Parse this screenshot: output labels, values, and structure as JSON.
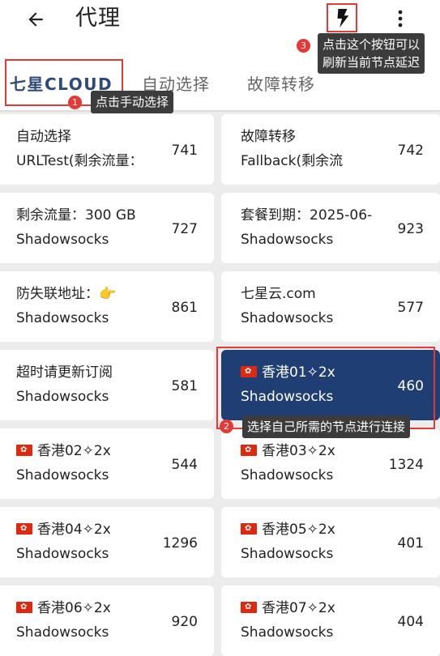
{
  "header": {
    "title": "代理",
    "back_icon": "arrow-left-icon",
    "bolt_icon": "lightning-bolt-icon",
    "more_icon": "more-vertical-icon"
  },
  "tabs": [
    {
      "label": "七星CLOUD",
      "active": true
    },
    {
      "label": "自动选择",
      "active": false
    },
    {
      "label": "故障转移",
      "active": false
    }
  ],
  "proxies": [
    {
      "name": "自动选择",
      "type": "URLTest(剩余流量：",
      "delay": "741"
    },
    {
      "name": "故障转移",
      "type": "Fallback(剩余流",
      "delay": "742"
    },
    {
      "name": "剩余流量：300 GB",
      "type": "Shadowsocks",
      "delay": "727"
    },
    {
      "name": "套餐到期：2025-06-",
      "type": "Shadowsocks",
      "delay": "923"
    },
    {
      "name": "防失联地址：👉",
      "type": "Shadowsocks",
      "delay": "861"
    },
    {
      "name": "七星云.com",
      "type": "Shadowsocks",
      "delay": "577"
    },
    {
      "name": "超时请更新订阅",
      "type": "Shadowsocks",
      "delay": "581"
    },
    {
      "name": "香港01✧2x",
      "type": "Shadowsocks",
      "delay": "460",
      "flag": "HK",
      "selected": true
    },
    {
      "name": "香港02✧2x",
      "type": "Shadowsocks",
      "delay": "544",
      "flag": "HK"
    },
    {
      "name": "香港03✧2x",
      "type": "Shadowsocks",
      "delay": "1324",
      "flag": "HK"
    },
    {
      "name": "香港04✧2x",
      "type": "Shadowsocks",
      "delay": "1296",
      "flag": "HK"
    },
    {
      "name": "香港05✧2x",
      "type": "Shadowsocks",
      "delay": "401",
      "flag": "HK"
    },
    {
      "name": "香港06✧2x",
      "type": "Shadowsocks",
      "delay": "920",
      "flag": "HK"
    },
    {
      "name": "香港07✧2x",
      "type": "Shadowsocks",
      "delay": "404",
      "flag": "HK"
    }
  ],
  "annotations": {
    "tip1": {
      "num": "1",
      "text": "点击手动选择"
    },
    "tip2": {
      "num": "2",
      "text": "选择自己所需的节点进行连接"
    },
    "tip3": {
      "num": "3",
      "line1": "点击这个按钮可以",
      "line2": "刷新当前节点延迟"
    }
  },
  "colors": {
    "accent": "#2d4a7a",
    "selected_card": "#1f3e73",
    "annotation_red": "#e53935",
    "tooltip_bg": "#3c3c3c"
  }
}
